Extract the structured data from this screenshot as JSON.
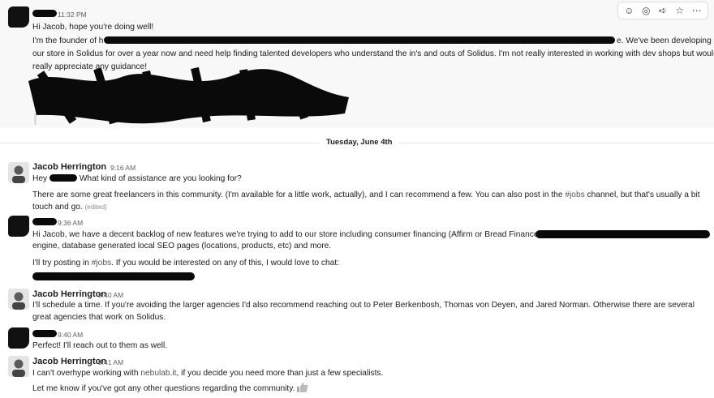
{
  "toolbar": {
    "icons": [
      "add-reaction-icon",
      "reply-thread-icon",
      "share-icon",
      "bookmark-icon",
      "more-icon"
    ]
  },
  "messages": [
    {
      "time": "11:32 PM",
      "lines": [
        "Hi Jacob, hope you're doing well!",
        "I'm the founder of h",
        "e. We've been developing",
        "our store in Solidus for over a year now and need help finding talented developers who understand the in's and outs of Solidus. I'm not really interested in working with dev shops but would",
        "really appreciate any guidance!"
      ]
    },
    {
      "name": "Jacob Herrington",
      "time": "9:16 AM",
      "greeting": "Hey",
      "greeting_rest": "What kind of assistance are you looking for?",
      "para1": "There are some great freelancers in this community. (I'm available for a little work, actually), and I can recommend a few. You can also post in the",
      "channel": "#jobs",
      "para1_rest": "channel, but that's usually a bit touch and go.",
      "edited": "(edited)"
    },
    {
      "time": "9:36 AM",
      "line1": "Hi Jacob, we have a decent backlog of new features we're trying to add to our store including consumer financing (Affirm or Bread Finance),",
      "line2": "engine, database generated local SEO pages (locations, products, etc) and more.",
      "line3_a": "I'll try posting in",
      "channel": "#jobs",
      "line3_b": ". If you would be interested on any of this, I would love to chat:"
    },
    {
      "name": "Jacob Herrington",
      "time": "9:40 AM",
      "text": "I'll schedule a time. If you're avoiding the larger agencies I'd also recommend reaching out to Peter Berkenbosh, Thomas von Deyen, and Jared Norman. Otherwise there are several great agencies that work on Solidus."
    },
    {
      "time": "9:40 AM",
      "text": "Perfect! I'll reach out to them as well."
    },
    {
      "name": "Jacob Herrington",
      "time": "9:41 AM",
      "line1_a": "I can't overhype working with",
      "link": "nebulab.it",
      "line1_b": ", if you decide you need more than just a few specialists.",
      "line2": "Let me know if you've got any other questions regarding the community."
    }
  ],
  "day_divider": "Tuesday, June 4th"
}
